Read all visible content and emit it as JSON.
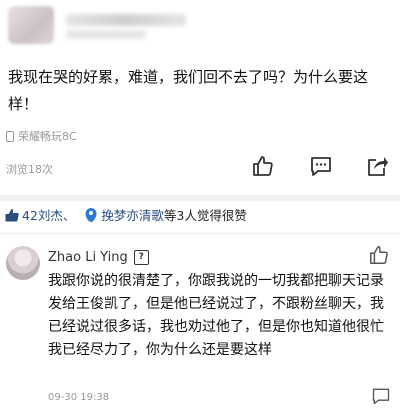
{
  "post": {
    "text": "我现在哭的好累，难道，我们回不去了吗？为什么要这样！",
    "device": "荣耀畅玩8C",
    "views": "浏览18次"
  },
  "likes": {
    "user1": "42刘杰、",
    "user2": "挽梦亦清歌",
    "suffix": "等3人觉得很赞"
  },
  "comment": {
    "author": "Zhao Li Ying",
    "badge": "?",
    "text": "我跟你说的很清楚了，你跟我说的一切我都把聊天记录发给王俊凯了，但是他已经说过了，不跟粉丝聊天，我已经说过很多话，我也劝过他了，但是你也知道他很忙我已经尽力了，你为什么还是要这样",
    "time": "09-30 19:38"
  },
  "icons": {
    "like": "thumbs-up-icon",
    "comment": "comment-icon",
    "share": "share-icon",
    "device": "phone-icon",
    "like_badge": "thumb-badge-icon",
    "user_badge": "user-badge-icon"
  },
  "colors": {
    "accent": "#2c4e7f",
    "muted": "#9a9a9a",
    "badge_blue": "#2b7bd6"
  }
}
